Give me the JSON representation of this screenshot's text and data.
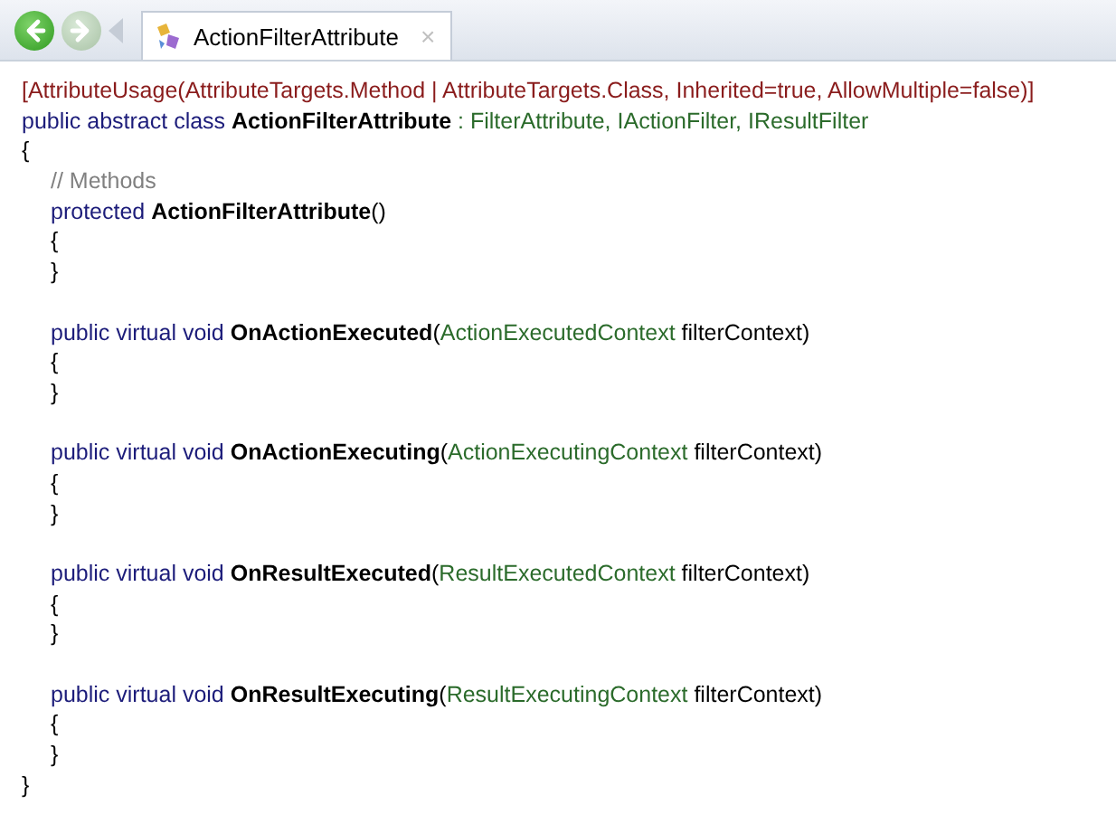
{
  "toolbar": {
    "back": {
      "disabled": false
    },
    "forward": {
      "disabled": true
    },
    "tab": {
      "label": "ActionFilterAttribute",
      "close": "×",
      "selected": true
    }
  },
  "code": [
    {
      "tokens": [
        {
          "kind": "attr",
          "text": "[AttributeUsage(AttributeTargets.Method | AttributeTargets.Class, Inherited=true, AllowMultiple=false)]"
        }
      ]
    },
    {
      "tokens": [
        {
          "kind": "keyword",
          "text": "public abstract class "
        },
        {
          "kind": "name",
          "text": "ActionFilterAttribute"
        },
        {
          "kind": "type",
          "text": " : FilterAttribute, IActionFilter, IResultFilter"
        }
      ]
    },
    {
      "tokens": [
        {
          "kind": "plain",
          "text": "{"
        }
      ],
      "children": [
        {
          "tokens": [
            {
              "kind": "comment",
              "text": "// Methods"
            }
          ]
        },
        {
          "tokens": [
            {
              "kind": "keyword",
              "text": "protected "
            },
            {
              "kind": "name",
              "text": "ActionFilterAttribute"
            },
            {
              "kind": "plain",
              "text": "()"
            }
          ]
        },
        {
          "tokens": [
            {
              "kind": "plain",
              "text": "{"
            }
          ]
        },
        {
          "tokens": [
            {
              "kind": "plain",
              "text": "}"
            }
          ]
        },
        {
          "kind": "blank"
        },
        {
          "tokens": [
            {
              "kind": "keyword",
              "text": "public virtual void "
            },
            {
              "kind": "name",
              "text": "OnActionExecuted"
            },
            {
              "kind": "plain",
              "text": "("
            },
            {
              "kind": "type",
              "text": "ActionExecutedContext"
            },
            {
              "kind": "plain",
              "text": " filterContext)"
            }
          ]
        },
        {
          "tokens": [
            {
              "kind": "plain",
              "text": "{"
            }
          ]
        },
        {
          "tokens": [
            {
              "kind": "plain",
              "text": "}"
            }
          ]
        },
        {
          "kind": "blank"
        },
        {
          "tokens": [
            {
              "kind": "keyword",
              "text": "public virtual void "
            },
            {
              "kind": "name",
              "text": "OnActionExecuting"
            },
            {
              "kind": "plain",
              "text": "("
            },
            {
              "kind": "type",
              "text": "ActionExecutingContext"
            },
            {
              "kind": "plain",
              "text": " filterContext)"
            }
          ]
        },
        {
          "tokens": [
            {
              "kind": "plain",
              "text": "{"
            }
          ]
        },
        {
          "tokens": [
            {
              "kind": "plain",
              "text": "}"
            }
          ]
        },
        {
          "kind": "blank"
        },
        {
          "tokens": [
            {
              "kind": "keyword",
              "text": "public virtual void "
            },
            {
              "kind": "name",
              "text": "OnResultExecuted"
            },
            {
              "kind": "plain",
              "text": "("
            },
            {
              "kind": "type",
              "text": "ResultExecutedContext"
            },
            {
              "kind": "plain",
              "text": " filterContext)"
            }
          ]
        },
        {
          "tokens": [
            {
              "kind": "plain",
              "text": "{"
            }
          ]
        },
        {
          "tokens": [
            {
              "kind": "plain",
              "text": "}"
            }
          ]
        },
        {
          "kind": "blank"
        },
        {
          "tokens": [
            {
              "kind": "keyword",
              "text": "public virtual void "
            },
            {
              "kind": "name",
              "text": "OnResultExecuting"
            },
            {
              "kind": "plain",
              "text": "("
            },
            {
              "kind": "type",
              "text": "ResultExecutingContext"
            },
            {
              "kind": "plain",
              "text": " filterContext)"
            }
          ]
        },
        {
          "tokens": [
            {
              "kind": "plain",
              "text": "{"
            }
          ]
        },
        {
          "tokens": [
            {
              "kind": "plain",
              "text": "}"
            }
          ]
        }
      ]
    },
    {
      "tokens": [
        {
          "kind": "plain",
          "text": "}"
        }
      ]
    }
  ]
}
